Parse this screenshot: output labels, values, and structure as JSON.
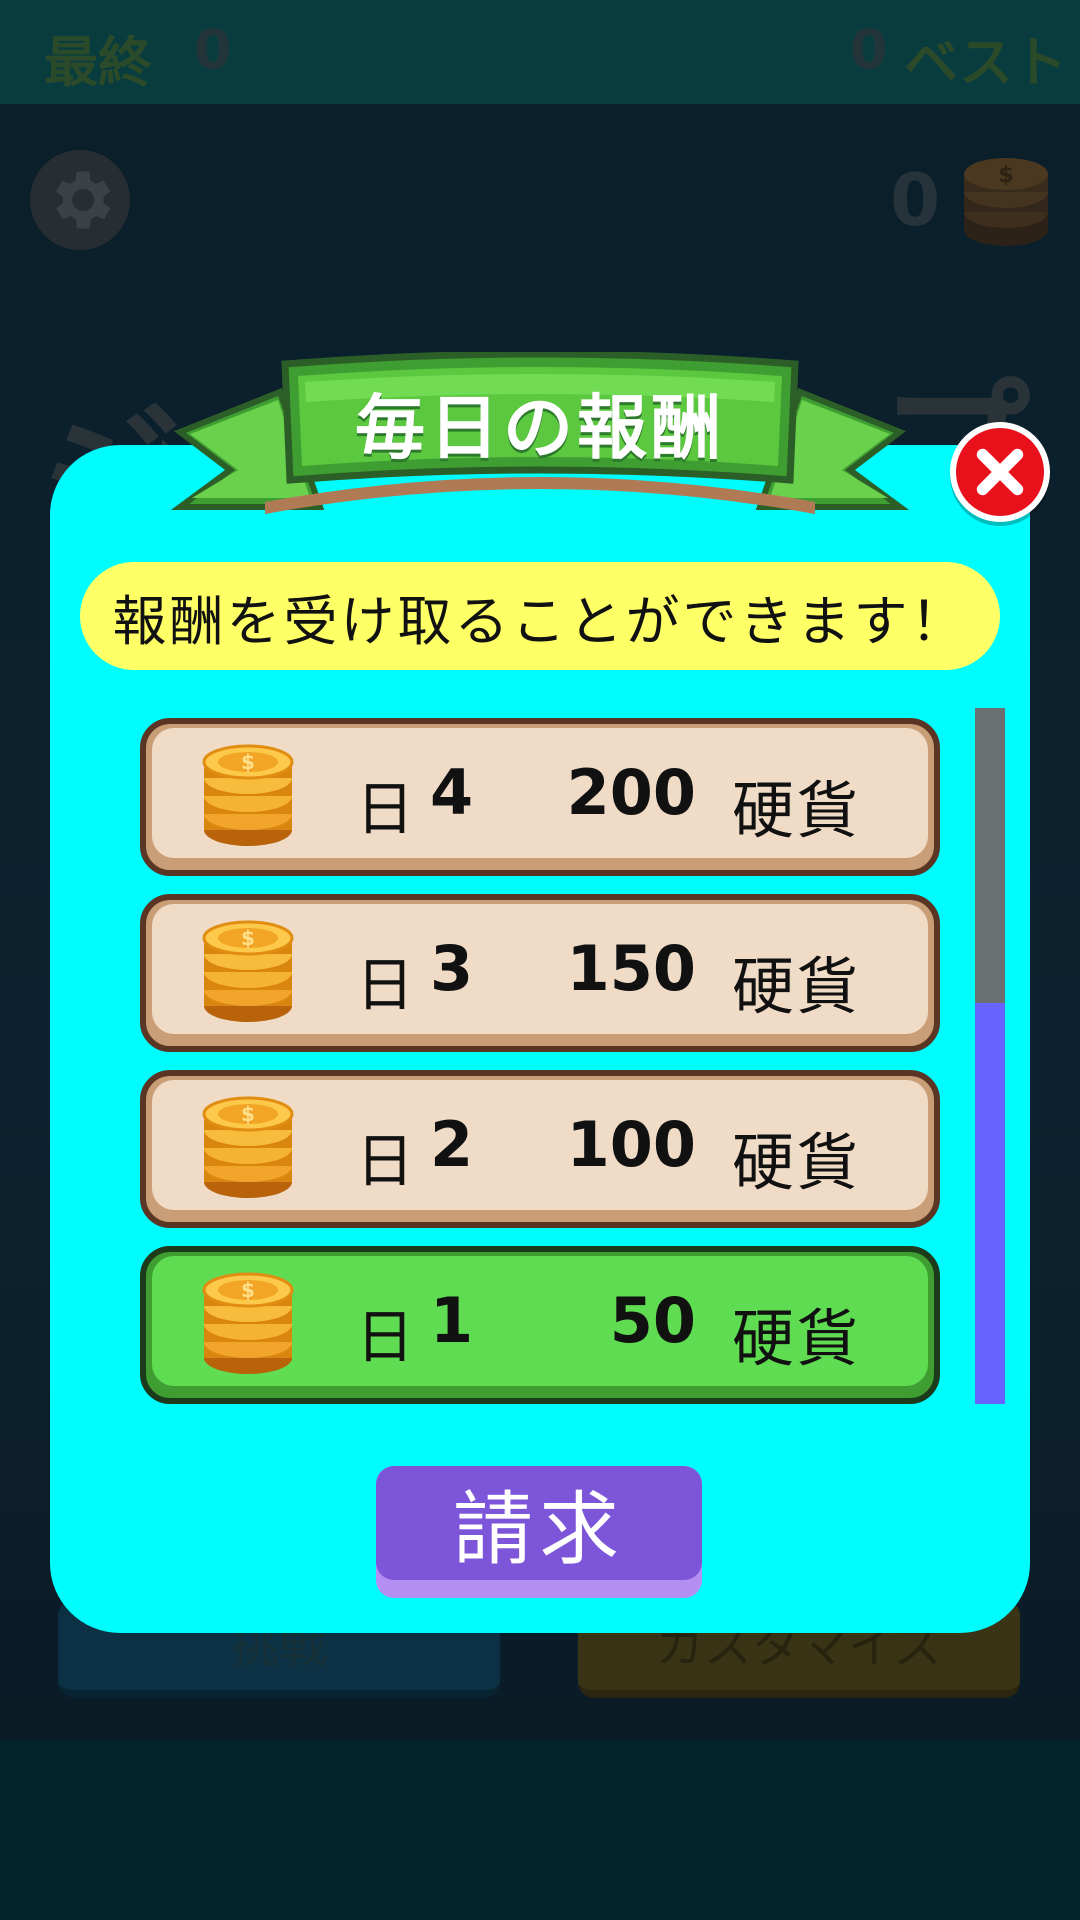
{
  "header": {
    "last_label": "最終",
    "last_score": "0",
    "best_score": "0",
    "best_label": "ベスト"
  },
  "hud": {
    "coin_total": "0",
    "settings_icon": "gear-icon",
    "coin_icon": "coin-stack-icon"
  },
  "background_title": {
    "left_fragment": "ジ",
    "right_fragment": "プ"
  },
  "background_buttons": {
    "left_label": "挑戦",
    "right_label": "カスタマイズ"
  },
  "dialog": {
    "title": "毎日の報酬",
    "message": "報酬を受け取ることができます！",
    "close_icon": "close-icon",
    "claim_label": "請求",
    "rewards": [
      {
        "day_label": "日",
        "day": "4",
        "amount": "200",
        "unit": "硬貨",
        "active": false
      },
      {
        "day_label": "日",
        "day": "3",
        "amount": "150",
        "unit": "硬貨",
        "active": false
      },
      {
        "day_label": "日",
        "day": "2",
        "amount": "100",
        "unit": "硬貨",
        "active": false
      },
      {
        "day_label": "日",
        "day": "1",
        "amount": "50",
        "unit": "硬貨",
        "active": true
      }
    ]
  },
  "colors": {
    "dialog_bg": "#00fdfd",
    "banner_green": "#5cc840",
    "message_bg": "#ffff66",
    "row_bg": "#f0dcc6",
    "row_active_bg": "#5fdc52",
    "claim_button": "#7d55d9",
    "close_button": "#e8101a",
    "scroll_thumb": "#6663ff"
  }
}
